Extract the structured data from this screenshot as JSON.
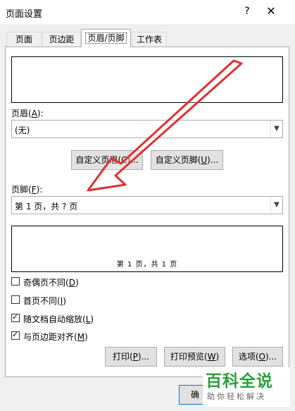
{
  "dialog": {
    "title": "页面设置",
    "help": "?",
    "close": "✕"
  },
  "tabs": [
    {
      "label": "页面"
    },
    {
      "label": "页边距"
    },
    {
      "label": "页眉/页脚",
      "active": true
    },
    {
      "label": "工作表"
    }
  ],
  "header": {
    "label_pre": "页眉(",
    "label_key": "A",
    "label_post": "):",
    "value": "(无)",
    "custom_button": "自定义页眉(C)..."
  },
  "footer": {
    "custom_button_pre": "自定义页脚(",
    "custom_button_key": "U",
    "custom_button_post": ")...",
    "label_pre": "页脚(",
    "label_key": "F",
    "label_post": "):",
    "value": "第 1 页，共 ? 页",
    "preview_text": "第 1 页，共 1 页"
  },
  "options": [
    {
      "pre": "奇偶页不同(",
      "key": "D",
      "post": ")",
      "checked": false
    },
    {
      "pre": "首页不同(",
      "key": "I",
      "post": ")",
      "checked": false
    },
    {
      "pre": "随文档自动缩放(",
      "key": "L",
      "post": ")",
      "checked": true
    },
    {
      "pre": "与页边距对齐(",
      "key": "M",
      "post": ")",
      "checked": true
    }
  ],
  "buttons": {
    "print_pre": "打印(",
    "print_key": "P",
    "print_post": ")...",
    "preview_pre": "打印预览(",
    "preview_key": "W",
    "preview_post": ")",
    "options_pre": "选项(",
    "options_key": "O",
    "options_post": ")...",
    "ok": "确"
  },
  "watermark": {
    "title": "百科全说",
    "subtitle": "助你轻松解决"
  },
  "colors": {
    "arrow": "#e03030",
    "watermark": "#2aa13c",
    "focus": "#0078d7"
  },
  "icons": {
    "dropdown": "chevron-down-icon",
    "checkbox": "checkmark-icon"
  }
}
